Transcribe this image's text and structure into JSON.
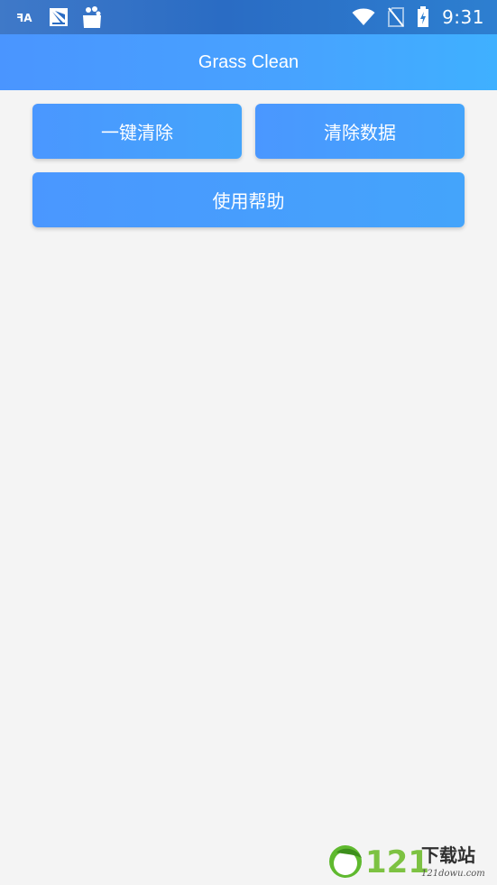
{
  "status_bar": {
    "time": "9:31",
    "left_icons": [
      "font-icon",
      "image-icon",
      "shopping-bag-icon"
    ],
    "right_icons": [
      "wifi-icon",
      "no-sim-icon",
      "battery-charging-icon"
    ]
  },
  "app_bar": {
    "title": "Grass Clean"
  },
  "buttons": {
    "one_key_clean": "一键清除",
    "clear_data": "清除数据",
    "help": "使用帮助"
  },
  "watermark": {
    "number": "121",
    "text": "下载站",
    "domain": "121dowu.com"
  },
  "colors": {
    "status_bar": "#2f72c6",
    "app_bar": "#47a3ff",
    "button": "#4a9dff",
    "background": "#f4f4f4"
  }
}
